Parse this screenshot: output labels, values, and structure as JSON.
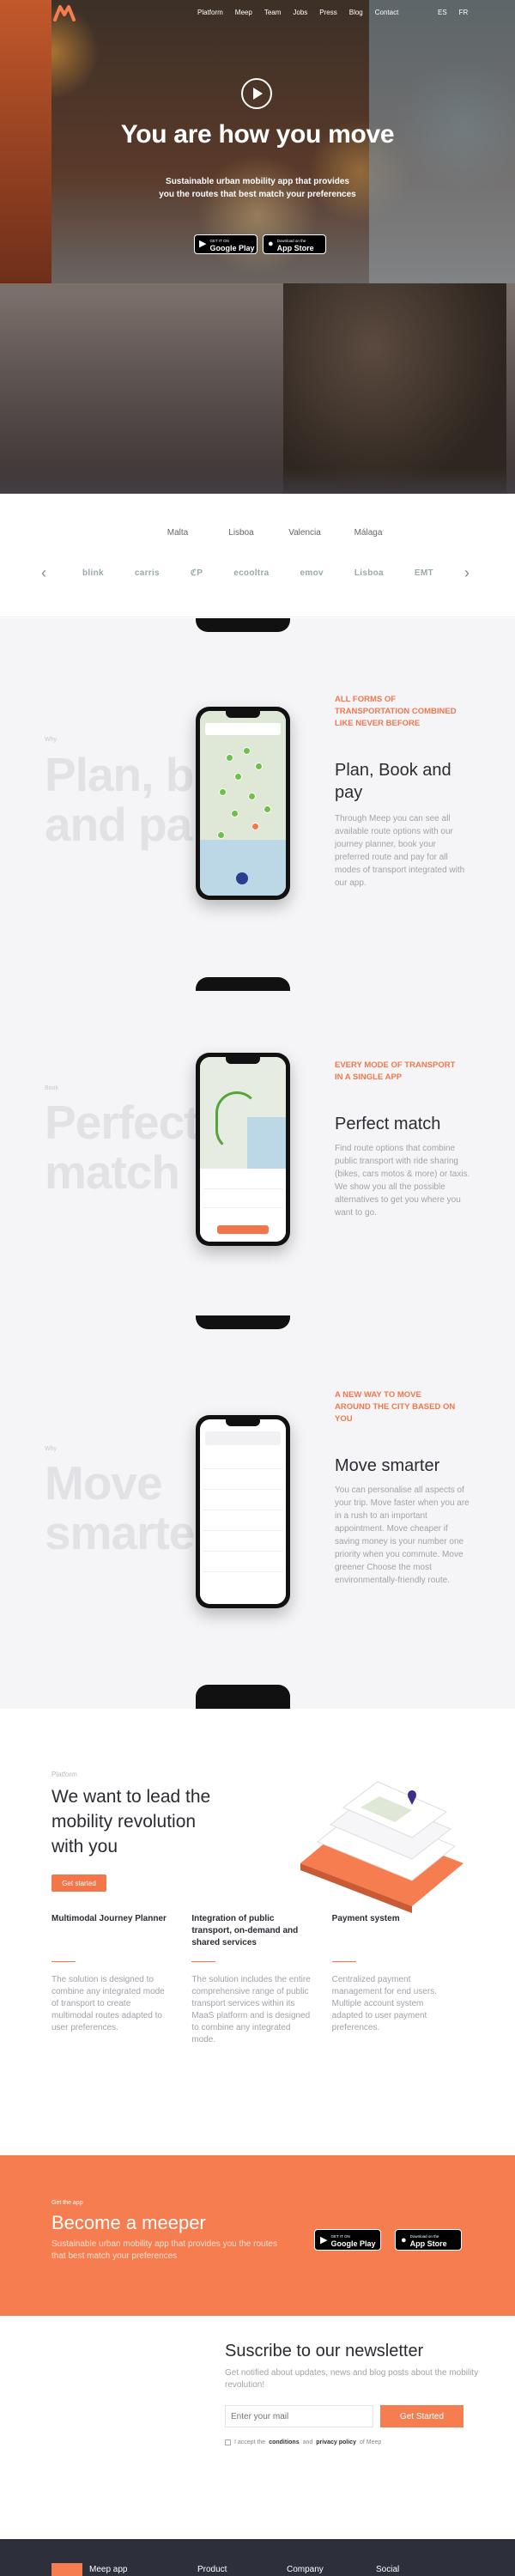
{
  "nav": {
    "items": [
      "Platform",
      "Meep",
      "Team",
      "Jobs",
      "Press",
      "Blog",
      "Contact"
    ],
    "lang": [
      "ES",
      "FR"
    ]
  },
  "hero": {
    "title": "You are how you move",
    "subtitle_line1": "Sustainable urban mobility app that provides",
    "subtitle_line2": "you the routes that best match your preferences",
    "google_small": "GET IT ON",
    "google_big": "Google Play",
    "apple_small": "Download on the",
    "apple_big": "App Store"
  },
  "cities": [
    "Malta",
    "Lisboa",
    "Valencia",
    "Málaga"
  ],
  "partners": [
    "blink",
    "carris",
    "ℭP",
    "ecooltra",
    "emov",
    "Lisboa",
    "EMT"
  ],
  "features": [
    {
      "ghost_tag": "Why",
      "ghost": [
        "Plan, b",
        "and pa"
      ],
      "kicker": [
        "All forms of",
        "transportation combined",
        "like never before"
      ],
      "title": [
        "Plan, Book and",
        "pay"
      ],
      "body": "Through Meep you can see all available route options with our journey planner, book your preferred route and pay for all modes of transport integrated with our app."
    },
    {
      "ghost_tag": "Book",
      "ghost": [
        "Perfect",
        "match"
      ],
      "kicker": [
        "Every mode of transport",
        "in a single app"
      ],
      "title": [
        "Perfect match"
      ],
      "body": "Find route options that combine public transport with ride sharing (bikes, cars motos & more) or taxis. We show you all the possible alternatives to get you where you want to go."
    },
    {
      "ghost_tag": "Why",
      "ghost": [
        "Move",
        "smarte"
      ],
      "kicker": [
        "A new way to move",
        "around the city based on",
        "you"
      ],
      "title": [
        "Move smarter"
      ],
      "body": "You can personalise all aspects of your trip. Move faster when you are in a rush to an important appointment. Move cheaper if saving money is your number one priority when you commute. Move greener Choose the most environmentally-friendly route."
    }
  ],
  "platform": {
    "tag": "Platform",
    "title": [
      "We want to lead the",
      "mobility revolution",
      "with you"
    ],
    "button": "Get started",
    "columns": [
      {
        "title": "Multimodal Journey Planner",
        "body": "The solution is designed to combine any integrated mode of transport to create multimodal routes adapted to user preferences."
      },
      {
        "title": "Integration of public transport, on-demand and shared services",
        "body": "The solution includes the entire comprehensive range of public transport services within its MaaS platform and is designed to combine any integrated mode."
      },
      {
        "title": "Payment system",
        "body": "Centralized payment management for end users. Multiple account system adapted to user payment preferences."
      }
    ]
  },
  "cta": {
    "kicker": "Get the app",
    "title": "Become a meeper",
    "body": "Sustainable urban mobility app that provides you the routes that best match your preferences"
  },
  "newsletter": {
    "title": "Suscribe to our newsletter",
    "desc": "Get notified about updates, news and blog posts about the mobility revolution!",
    "placeholder": "Enter your mail",
    "button": "Get Started",
    "consent_pre": "I accept the",
    "consent_a": "conditions",
    "consent_mid": "and",
    "consent_b": "privacy policy",
    "consent_post": "of Meep"
  },
  "footer": {
    "logo_text": "Meep app",
    "cols": [
      "Product",
      "Company",
      "Social"
    ]
  },
  "colors": {
    "accent": "#f57d4f",
    "dark": "#2d2f3b",
    "green": "#6fbf4b"
  }
}
